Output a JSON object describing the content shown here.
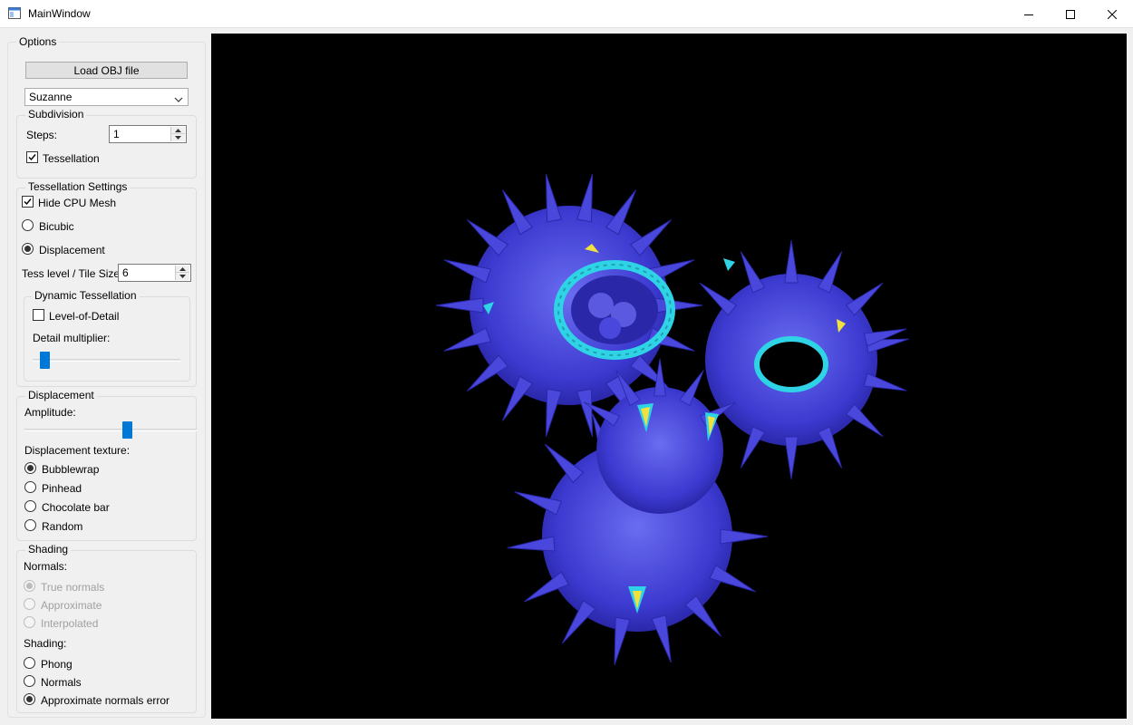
{
  "window": {
    "title": "MainWindow",
    "icon": "app-window-icon"
  },
  "options": {
    "title": "Options",
    "load_button": "Load OBJ file",
    "model_combo": {
      "selected": "Suzanne"
    }
  },
  "subdivision": {
    "title": "Subdivision",
    "steps_label": "Steps:",
    "steps_value": "1",
    "tessellation_label": "Tessellation",
    "tessellation_checked": true
  },
  "tessellation_settings": {
    "title": "Tessellation Settings",
    "hide_cpu_mesh_label": "Hide CPU Mesh",
    "hide_cpu_mesh_checked": true,
    "bicubic_label": "Bicubic",
    "displacement_label": "Displacement",
    "selected_mode": "Displacement",
    "tess_level_label": "Tess level / Tile Size",
    "tess_level_value": "6"
  },
  "dynamic_tessellation": {
    "title": "Dynamic Tessellation",
    "lod_label": "Level-of-Detail",
    "lod_checked": false,
    "detail_multiplier_label": "Detail multiplier:",
    "detail_multiplier_level": 0.05
  },
  "displacement": {
    "title": "Displacement",
    "amplitude_label": "Amplitude:",
    "amplitude_level": 0.5,
    "texture_label": "Displacement texture:",
    "textures": [
      "Bubblewrap",
      "Pinhead",
      "Chocolate bar",
      "Random"
    ],
    "selected_texture": "Bubblewrap"
  },
  "shading": {
    "title": "Shading",
    "normals_label": "Normals:",
    "normals_options": [
      "True normals",
      "Approximate",
      "Interpolated"
    ],
    "normals_selected": "True normals",
    "normals_enabled": false,
    "shading_label": "Shading:",
    "shading_options": [
      "Phong",
      "Normals",
      "Approximate normals error"
    ],
    "shading_selected": "Approximate normals error"
  },
  "colors": {
    "viewport_bg": "#000000",
    "mesh_base": "#3c3ad0",
    "mesh_highlight": "#6a6cf0",
    "error_cyan": "#2fd3e6",
    "error_yellow": "#f0e040",
    "slider_accent": "#0078d7"
  }
}
